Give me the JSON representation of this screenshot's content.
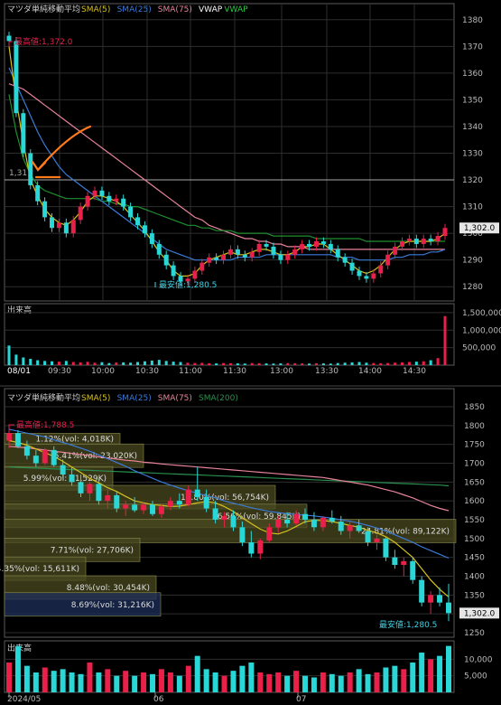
{
  "colors": {
    "bg": "#000000",
    "grid": "#2e2e2e",
    "border": "#5a5a5a",
    "up": "#e8204a",
    "down": "#2ad7d7",
    "sma5": "#d6c21e",
    "sma25": "#3b7bd8",
    "sma75": "#e8839a",
    "vwap": "#1f8f2f",
    "sma200": "#2a8f4f",
    "accent": "#ff7a1a",
    "text": "#cfcfcf",
    "label_bg": "#222222"
  },
  "panel1": {
    "header": {
      "stock": "マツダ",
      "type": "単純移動平均",
      "legend": [
        {
          "name": "SMA(5)",
          "color": "#d6c21e"
        },
        {
          "name": "SMA(25)",
          "color": "#3b7bd8"
        },
        {
          "name": "SMA(75)",
          "color": "#e8839a"
        },
        {
          "name": "VWAP",
          "color": "#ffffff"
        },
        {
          "name": "VWAP",
          "color": "#27c93f"
        }
      ]
    },
    "high_label": "最高値:1,372.0",
    "low_label": "最安値:1,280.5",
    "level_label": "1,31",
    "last_price": "1,302.0",
    "volume_title": "出来高",
    "date_label": "08/01"
  },
  "panel2": {
    "header": {
      "stock": "マツダ",
      "type": "単純移動平均",
      "legend": [
        {
          "name": "SMA(5)",
          "color": "#d6c21e"
        },
        {
          "name": "SMA(25)",
          "color": "#3b7bd8"
        },
        {
          "name": "SMA(75)",
          "color": "#e8839a"
        },
        {
          "name": "SMA(200)",
          "color": "#2a8f4f"
        }
      ]
    },
    "high_label": "最高値:1,788.5",
    "low_label": "最安値:1,280.5",
    "last_price": "1,302.0",
    "volume_title": "出来高",
    "profile_labels": [
      "1.12%(vol: 4,018K)",
      "5.41%(vol: 23,020K)",
      "5.99%(vol: 21,529K)",
      "15.80%(vol: 56,754K)",
      "16.56%(vol: 59,845K)",
      "24.81%(vol: 89,122K)",
      "7.71%(vol: 27,706K)",
      "4.35%(vol: 15,611K)",
      "8.48%(vol: 30,454K)",
      "8.69%(vol: 31,216K)"
    ]
  },
  "chart_data": [
    {
      "type": "candlestick",
      "title": "マツダ 単純移動平均 (intraday 08/01)",
      "x_ticks": [
        "09:30",
        "10:00",
        "10:30",
        "11:00",
        "11:30",
        "13:00",
        "13:30",
        "14:00",
        "14:30"
      ],
      "y_ticks": [
        1280,
        1290,
        1300,
        1310,
        1320,
        1330,
        1340,
        1350,
        1360,
        1370,
        1380
      ],
      "ylim": [
        1275,
        1385
      ],
      "reference_line": 1320,
      "close": [
        1372,
        1345,
        1330,
        1318,
        1312,
        1306,
        1302,
        1304,
        1300,
        1305,
        1310,
        1314,
        1316,
        1314,
        1312,
        1313,
        1310,
        1306,
        1303,
        1300,
        1296,
        1292,
        1288,
        1284,
        1282,
        1283,
        1286,
        1289,
        1291,
        1290,
        1292,
        1294,
        1292,
        1291,
        1293,
        1296,
        1295,
        1292,
        1290,
        1292,
        1294,
        1296,
        1295,
        1297,
        1296,
        1294,
        1291,
        1289,
        1286,
        1284,
        1283,
        1285,
        1288,
        1292,
        1295,
        1297,
        1298,
        1296,
        1298,
        1297,
        1299,
        1302
      ],
      "sma5": [
        1370,
        1350,
        1334,
        1320,
        1314,
        1309,
        1306,
        1304,
        1303,
        1305,
        1308,
        1312,
        1314,
        1314,
        1313,
        1312,
        1310,
        1307,
        1304,
        1301,
        1297,
        1293,
        1290,
        1286,
        1284,
        1284,
        1285,
        1288,
        1290,
        1291,
        1292,
        1293,
        1292,
        1292,
        1293,
        1294,
        1294,
        1293,
        1292,
        1292,
        1293,
        1295,
        1295,
        1296,
        1296,
        1294,
        1292,
        1290,
        1288,
        1286,
        1285,
        1286,
        1288,
        1291,
        1294,
        1296,
        1297,
        1297,
        1297,
        1297,
        1298,
        1300
      ],
      "sma25": [
        1362,
        1356,
        1350,
        1344,
        1338,
        1333,
        1329,
        1325,
        1322,
        1320,
        1318,
        1316,
        1314,
        1312,
        1310,
        1308,
        1306,
        1304,
        1302,
        1300,
        1298,
        1296,
        1294,
        1293,
        1292,
        1291,
        1290,
        1290,
        1290,
        1290,
        1290,
        1290,
        1291,
        1291,
        1291,
        1291,
        1292,
        1292,
        1292,
        1292,
        1292,
        1292,
        1292,
        1292,
        1292,
        1292,
        1291,
        1291,
        1291,
        1290,
        1290,
        1290,
        1290,
        1290,
        1291,
        1291,
        1292,
        1292,
        1292,
        1293,
        1293,
        1294
      ],
      "sma75": [
        1356,
        1355,
        1354,
        1352,
        1350,
        1348,
        1346,
        1344,
        1342,
        1340,
        1338,
        1336,
        1334,
        1332,
        1330,
        1328,
        1326,
        1324,
        1322,
        1320,
        1318,
        1316,
        1314,
        1312,
        1310,
        1308,
        1306,
        1305,
        1303,
        1302,
        1301,
        1300,
        1299,
        1298,
        1298,
        1297,
        1297,
        1296,
        1296,
        1295,
        1295,
        1295,
        1294,
        1294,
        1294,
        1294,
        1294,
        1294,
        1294,
        1294,
        1294,
        1294,
        1294,
        1294,
        1294,
        1294,
        1294,
        1294,
        1294,
        1294,
        1294,
        1294
      ],
      "vwap": [
        1352,
        1338,
        1328,
        1322,
        1318,
        1316,
        1315,
        1314,
        1313,
        1313,
        1313,
        1313,
        1313,
        1312,
        1312,
        1311,
        1311,
        1310,
        1310,
        1309,
        1308,
        1307,
        1306,
        1305,
        1304,
        1303,
        1303,
        1302,
        1302,
        1301,
        1301,
        1301,
        1300,
        1300,
        1300,
        1300,
        1300,
        1299,
        1299,
        1299,
        1299,
        1299,
        1299,
        1298,
        1298,
        1298,
        1298,
        1298,
        1298,
        1298,
        1297,
        1297,
        1297,
        1297,
        1297,
        1297,
        1297,
        1297,
        1297,
        1297,
        1297,
        1297
      ],
      "volume_ticks": [
        500000,
        1000000,
        1500000
      ],
      "volume": [
        560000,
        300000,
        220000,
        180000,
        140000,
        120000,
        110000,
        100000,
        120000,
        90000,
        80000,
        95000,
        70000,
        85000,
        60000,
        75000,
        80000,
        70000,
        90000,
        110000,
        130000,
        150000,
        120000,
        100000,
        90000,
        70000,
        60000,
        65000,
        55000,
        50000,
        60000,
        55000,
        50000,
        45000,
        60000,
        55000,
        50000,
        45000,
        50000,
        60000,
        55000,
        50000,
        45000,
        55000,
        50000,
        45000,
        60000,
        70000,
        80000,
        90000,
        70000,
        60000,
        55000,
        60000,
        70000,
        80000,
        90000,
        100000,
        110000,
        140000,
        200000,
        1400000
      ]
    },
    {
      "type": "candlestick",
      "title": "マツダ 単純移動平均 (daily)",
      "x_ticks": [
        "2024/05",
        "06",
        "07"
      ],
      "y_ticks": [
        1250,
        1300,
        1350,
        1400,
        1450,
        1500,
        1550,
        1600,
        1650,
        1700,
        1750,
        1800,
        1850
      ],
      "ylim": [
        1230,
        1870
      ],
      "ohlc": [
        {
          "o": 1760,
          "h": 1790,
          "l": 1740,
          "c": 1780
        },
        {
          "o": 1780,
          "h": 1788,
          "l": 1740,
          "c": 1745
        },
        {
          "o": 1745,
          "h": 1760,
          "l": 1710,
          "c": 1720
        },
        {
          "o": 1720,
          "h": 1735,
          "l": 1690,
          "c": 1700
        },
        {
          "o": 1700,
          "h": 1740,
          "l": 1695,
          "c": 1735
        },
        {
          "o": 1735,
          "h": 1745,
          "l": 1690,
          "c": 1695
        },
        {
          "o": 1695,
          "h": 1710,
          "l": 1660,
          "c": 1670
        },
        {
          "o": 1670,
          "h": 1690,
          "l": 1640,
          "c": 1650
        },
        {
          "o": 1650,
          "h": 1670,
          "l": 1610,
          "c": 1620
        },
        {
          "o": 1620,
          "h": 1650,
          "l": 1600,
          "c": 1645
        },
        {
          "o": 1645,
          "h": 1660,
          "l": 1590,
          "c": 1600
        },
        {
          "o": 1600,
          "h": 1630,
          "l": 1580,
          "c": 1615
        },
        {
          "o": 1615,
          "h": 1625,
          "l": 1570,
          "c": 1580
        },
        {
          "o": 1580,
          "h": 1600,
          "l": 1560,
          "c": 1590
        },
        {
          "o": 1590,
          "h": 1610,
          "l": 1570,
          "c": 1575
        },
        {
          "o": 1575,
          "h": 1595,
          "l": 1565,
          "c": 1590
        },
        {
          "o": 1590,
          "h": 1600,
          "l": 1560,
          "c": 1565
        },
        {
          "o": 1565,
          "h": 1590,
          "l": 1555,
          "c": 1585
        },
        {
          "o": 1585,
          "h": 1610,
          "l": 1575,
          "c": 1600
        },
        {
          "o": 1600,
          "h": 1620,
          "l": 1580,
          "c": 1590
        },
        {
          "o": 1590,
          "h": 1640,
          "l": 1585,
          "c": 1630
        },
        {
          "o": 1630,
          "h": 1690,
          "l": 1600,
          "c": 1610
        },
        {
          "o": 1610,
          "h": 1630,
          "l": 1570,
          "c": 1580
        },
        {
          "o": 1580,
          "h": 1600,
          "l": 1540,
          "c": 1550
        },
        {
          "o": 1550,
          "h": 1570,
          "l": 1530,
          "c": 1560
        },
        {
          "o": 1560,
          "h": 1575,
          "l": 1520,
          "c": 1530
        },
        {
          "o": 1530,
          "h": 1545,
          "l": 1480,
          "c": 1490
        },
        {
          "o": 1490,
          "h": 1520,
          "l": 1450,
          "c": 1460
        },
        {
          "o": 1460,
          "h": 1500,
          "l": 1445,
          "c": 1495
        },
        {
          "o": 1495,
          "h": 1540,
          "l": 1490,
          "c": 1530
        },
        {
          "o": 1530,
          "h": 1560,
          "l": 1515,
          "c": 1550
        },
        {
          "o": 1550,
          "h": 1570,
          "l": 1530,
          "c": 1540
        },
        {
          "o": 1540,
          "h": 1575,
          "l": 1535,
          "c": 1565
        },
        {
          "o": 1565,
          "h": 1580,
          "l": 1540,
          "c": 1550
        },
        {
          "o": 1550,
          "h": 1570,
          "l": 1520,
          "c": 1530
        },
        {
          "o": 1530,
          "h": 1560,
          "l": 1520,
          "c": 1555
        },
        {
          "o": 1555,
          "h": 1575,
          "l": 1540,
          "c": 1545
        },
        {
          "o": 1545,
          "h": 1560,
          "l": 1510,
          "c": 1520
        },
        {
          "o": 1520,
          "h": 1545,
          "l": 1500,
          "c": 1535
        },
        {
          "o": 1535,
          "h": 1550,
          "l": 1515,
          "c": 1520
        },
        {
          "o": 1520,
          "h": 1530,
          "l": 1480,
          "c": 1490
        },
        {
          "o": 1490,
          "h": 1510,
          "l": 1470,
          "c": 1500
        },
        {
          "o": 1500,
          "h": 1505,
          "l": 1440,
          "c": 1450
        },
        {
          "o": 1450,
          "h": 1470,
          "l": 1420,
          "c": 1430
        },
        {
          "o": 1430,
          "h": 1450,
          "l": 1400,
          "c": 1440
        },
        {
          "o": 1440,
          "h": 1450,
          "l": 1380,
          "c": 1390
        },
        {
          "o": 1390,
          "h": 1400,
          "l": 1320,
          "c": 1330
        },
        {
          "o": 1330,
          "h": 1360,
          "l": 1300,
          "c": 1350
        },
        {
          "o": 1350,
          "h": 1370,
          "l": 1320,
          "c": 1330
        },
        {
          "o": 1330,
          "h": 1380,
          "l": 1281,
          "c": 1302
        }
      ],
      "sma5": [
        1760,
        1755,
        1748,
        1738,
        1728,
        1718,
        1705,
        1690,
        1675,
        1660,
        1648,
        1635,
        1625,
        1612,
        1600,
        1595,
        1590,
        1588,
        1585,
        1586,
        1590,
        1595,
        1598,
        1595,
        1585,
        1572,
        1555,
        1540,
        1525,
        1515,
        1512,
        1520,
        1532,
        1545,
        1548,
        1548,
        1545,
        1540,
        1535,
        1530,
        1522,
        1515,
        1505,
        1490,
        1470,
        1450,
        1420,
        1390,
        1365,
        1345
      ],
      "sma25": [
        1790,
        1785,
        1780,
        1775,
        1770,
        1762,
        1755,
        1748,
        1740,
        1732,
        1722,
        1712,
        1702,
        1692,
        1680,
        1670,
        1660,
        1650,
        1642,
        1634,
        1627,
        1620,
        1614,
        1608,
        1600,
        1594,
        1588,
        1582,
        1577,
        1572,
        1569,
        1566,
        1564,
        1562,
        1560,
        1557,
        1554,
        1550,
        1546,
        1541,
        1535,
        1528,
        1520,
        1510,
        1500,
        1490,
        1478,
        1468,
        1458,
        1448
      ],
      "sma75": [
        1745,
        1743,
        1741,
        1738,
        1735,
        1732,
        1729,
        1726,
        1723,
        1720,
        1717,
        1714,
        1711,
        1708,
        1706,
        1703,
        1701,
        1698,
        1696,
        1694,
        1692,
        1690,
        1688,
        1686,
        1684,
        1682,
        1680,
        1678,
        1676,
        1674,
        1672,
        1670,
        1668,
        1666,
        1664,
        1662,
        1658,
        1654,
        1650,
        1646,
        1642,
        1636,
        1630,
        1624,
        1616,
        1608,
        1598,
        1588,
        1580,
        1574
      ],
      "sma200": [
        1690,
        1689,
        1688,
        1687,
        1686,
        1685,
        1684,
        1683,
        1682,
        1681,
        1680,
        1679,
        1678,
        1677,
        1676,
        1675,
        1674,
        1673,
        1672,
        1671,
        1670,
        1669,
        1668,
        1667,
        1666,
        1665,
        1664,
        1663,
        1662,
        1661,
        1660,
        1659,
        1658,
        1657,
        1656,
        1655,
        1654,
        1653,
        1652,
        1651,
        1650,
        1649,
        1648,
        1647,
        1646,
        1645,
        1644,
        1643,
        1642,
        1640
      ],
      "volume_ticks": [
        5000,
        10000
      ],
      "volume": [
        9000,
        14000,
        8000,
        6000,
        7500,
        6500,
        7000,
        6000,
        5500,
        9000,
        6000,
        7000,
        5000,
        6500,
        5000,
        6000,
        5500,
        7000,
        6000,
        5000,
        8000,
        11000,
        7000,
        6000,
        5000,
        6500,
        8000,
        9000,
        6000,
        5500,
        6000,
        5000,
        6500,
        5000,
        4500,
        6000,
        5500,
        5000,
        6000,
        7000,
        5500,
        6000,
        7500,
        8000,
        7000,
        9000,
        12000,
        10000,
        11000,
        14000
      ]
    }
  ]
}
